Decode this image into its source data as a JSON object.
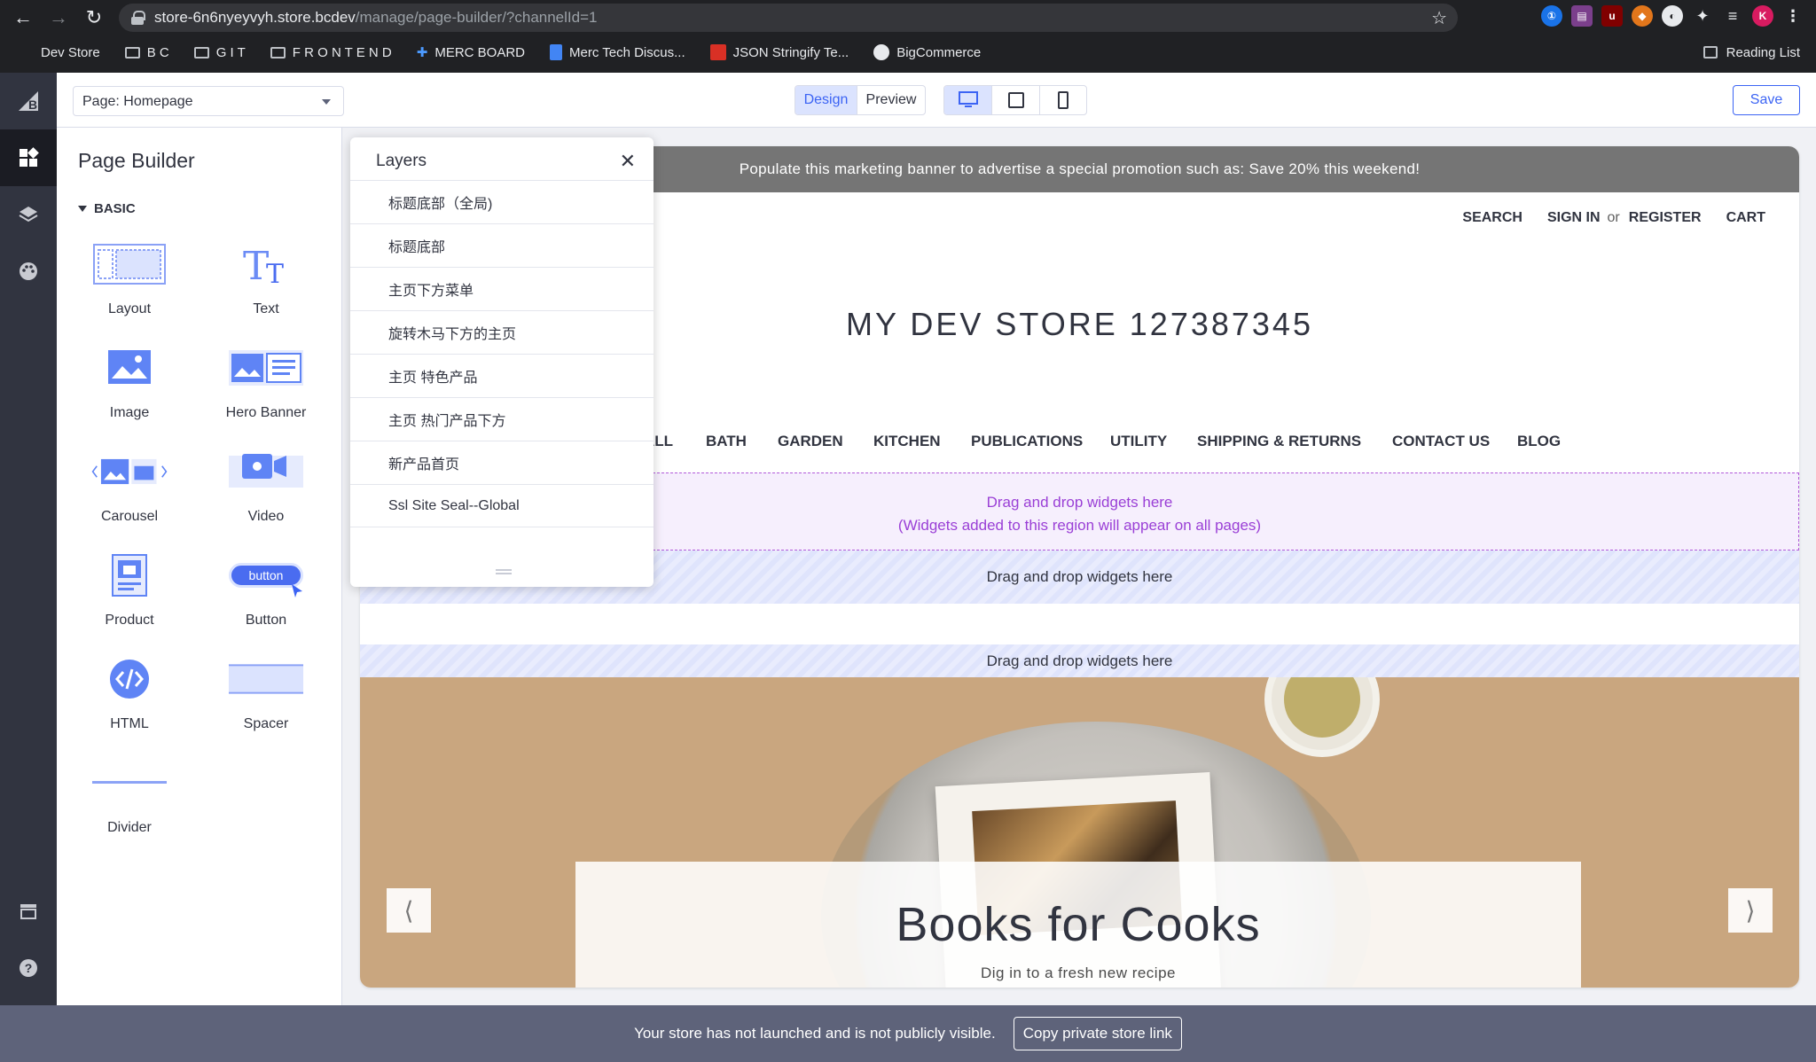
{
  "browser": {
    "url_host": "store-6n6nyeyvyh.store.bcdev",
    "url_path": "/manage/page-builder/?channelId=1",
    "profile_initial": "K",
    "bookmarks": [
      {
        "label": "Dev Store",
        "type": "plain"
      },
      {
        "label": "B C",
        "type": "folder"
      },
      {
        "label": "G I T",
        "type": "folder"
      },
      {
        "label": "F R O N T E N D",
        "type": "folder"
      },
      {
        "label": "MERC BOARD",
        "type": "jira"
      },
      {
        "label": "Merc Tech Discus...",
        "type": "doc"
      },
      {
        "label": "JSON Stringify Te...",
        "type": "tool"
      },
      {
        "label": "BigCommerce",
        "type": "github"
      }
    ],
    "reading_list": "Reading List"
  },
  "toolbar": {
    "page_select": "Page: Homepage",
    "design_label": "Design",
    "preview_label": "Preview",
    "save_label": "Save"
  },
  "panel": {
    "title": "Page Builder",
    "section": "BASIC",
    "widgets": [
      {
        "label": "Layout",
        "icon": "layout-icon"
      },
      {
        "label": "Text",
        "icon": "text-icon"
      },
      {
        "label": "Image",
        "icon": "image-icon"
      },
      {
        "label": "Hero Banner",
        "icon": "hero-banner-icon"
      },
      {
        "label": "Carousel",
        "icon": "carousel-icon"
      },
      {
        "label": "Video",
        "icon": "video-icon"
      },
      {
        "label": "Product",
        "icon": "product-icon"
      },
      {
        "label": "Button",
        "icon": "button-icon"
      },
      {
        "label": "HTML",
        "icon": "html-icon"
      },
      {
        "label": "Spacer",
        "icon": "spacer-icon"
      },
      {
        "label": "Divider",
        "icon": "divider-icon"
      }
    ],
    "button_icon_text": "button"
  },
  "layers": {
    "title": "Layers",
    "items": [
      "标题底部（全局)",
      "标题底部",
      "主页下方菜单",
      "旋转木马下方的主页",
      "主页 特色产品",
      "主页 热门产品下方",
      "新产品首页",
      "Ssl Site Seal--Global"
    ]
  },
  "store": {
    "promo": "Populate this marketing banner to advertise a special promotion such as: Save 20% this weekend!",
    "search": "SEARCH",
    "sign_in": "SIGN IN",
    "or": "or",
    "register": "REGISTER",
    "cart": "CART",
    "logo": "MY DEV STORE 127387345",
    "menu": [
      "ALL",
      "BATH",
      "GARDEN",
      "KITCHEN",
      "PUBLICATIONS",
      "UTILITY",
      "SHIPPING & RETURNS",
      "CONTACT US",
      "BLOG"
    ],
    "global_region_line1": "Drag and drop widgets here",
    "global_region_line2": "(Widgets added to this region will appear on all pages)",
    "dd_region": "Drag and drop widgets here",
    "hero_title": "Books for Cooks",
    "hero_subtitle": "Dig in to a fresh new recipe"
  },
  "bottom": {
    "notice": "Your store has not launched and is not publicly visible.",
    "copy_link": "Copy private store link"
  },
  "colors": {
    "accent": "#3c64f4",
    "rail": "#313440",
    "promo_bg": "#757575",
    "global_region": "#9a3fd6",
    "bottom_bar": "#5e637a"
  }
}
